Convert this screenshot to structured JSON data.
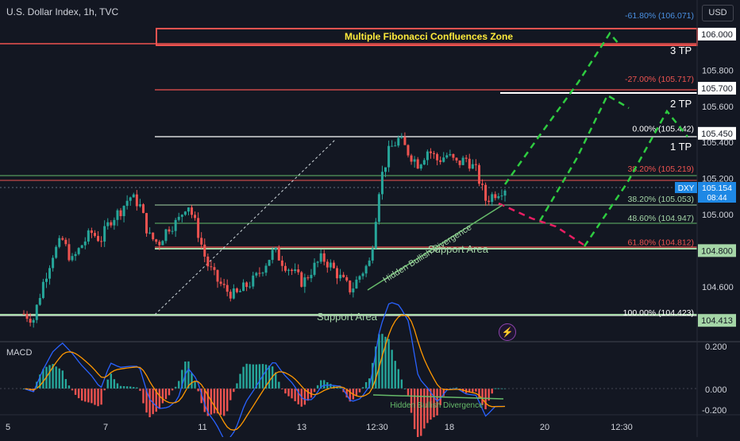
{
  "header": {
    "title": "U.S. Dollar Index, 1h, TVC",
    "currency_button": "USD"
  },
  "macd": {
    "label": "MACD",
    "axis_ticks": [
      "0.200",
      "0.000",
      "-0.200"
    ]
  },
  "annotations": {
    "confluence_zone": "Multiple Fibonacci Confluences Zone",
    "tp1": "1 TP",
    "tp2": "2 TP",
    "tp3": "3 TP",
    "support_upper": "Support Area",
    "support_lower": "Support Area",
    "hidden_div_price": "Hidden Bullish Divergence",
    "hidden_div_macd": "Hidden Bullish Divergence"
  },
  "fib_labels": [
    {
      "text": "-61.80% (106.071)",
      "value": 106.071,
      "color": "#4a90e2"
    },
    {
      "text": "-27.00% (105.717)",
      "value": 105.717,
      "color": "#ef5350"
    },
    {
      "text": "0.00% (105.442)",
      "value": 105.442,
      "color": "#ffffff"
    },
    {
      "text": "38.20% (105.219)",
      "value": 105.219,
      "color": "#ef5350"
    },
    {
      "text": "38.20% (105.053)",
      "value": 105.053,
      "color": "#a5d6a7"
    },
    {
      "text": "48.60% (104.947)",
      "value": 104.947,
      "color": "#a5d6a7"
    },
    {
      "text": "61.80% (104.812)",
      "value": 104.812,
      "color": "#ef5350"
    },
    {
      "text": "100.00% (104.423)",
      "value": 104.423,
      "color": "#ffffff"
    }
  ],
  "price_badges": [
    {
      "text": "106.000",
      "value": 106.0,
      "bg": "#ffffff",
      "fg": "#131722"
    },
    {
      "text": "105.700",
      "value": 105.7,
      "bg": "#ffffff",
      "fg": "#131722"
    },
    {
      "text": "105.450",
      "value": 105.45,
      "bg": "#ffffff",
      "fg": "#131722"
    },
    {
      "text": "104.800",
      "value": 104.8,
      "bg": "#a5d6a7",
      "fg": "#131722"
    },
    {
      "text": "104.413",
      "value": 104.413,
      "bg": "#a5d6a7",
      "fg": "#131722"
    }
  ],
  "current_price": {
    "symbol": "DXY",
    "price": "105.154",
    "countdown": "08:44",
    "value": 105.154
  },
  "chart_data": {
    "type": "candlestick",
    "title": "U.S. Dollar Index, 1h, TVC",
    "y_ticks": [
      105.8,
      105.6,
      105.4,
      105.2,
      105.0,
      104.6
    ],
    "y_tick_labels": [
      "105.800",
      "105.600",
      "105.400",
      "105.200",
      "105.000",
      "104.600"
    ],
    "ylim": [
      104.27,
      106.16
    ],
    "x_tick_labels": [
      "5",
      "7",
      "11",
      "13",
      "12:30",
      "18",
      "20",
      "12:30"
    ],
    "close_path": [
      [
        0,
        104.45
      ],
      [
        1,
        104.42
      ],
      [
        2,
        104.62
      ],
      [
        3,
        104.78
      ],
      [
        4,
        104.86
      ],
      [
        5,
        104.74
      ],
      [
        6,
        104.83
      ],
      [
        7,
        104.9
      ],
      [
        8,
        104.86
      ],
      [
        9,
        104.97
      ],
      [
        10,
        105.02
      ],
      [
        11,
        105.1
      ],
      [
        12,
        105.06
      ],
      [
        13,
        104.88
      ],
      [
        14,
        104.84
      ],
      [
        15,
        104.93
      ],
      [
        16,
        104.96
      ],
      [
        17,
        105.07
      ],
      [
        18,
        104.92
      ],
      [
        19,
        104.73
      ],
      [
        20,
        104.64
      ],
      [
        21,
        104.58
      ],
      [
        22,
        104.55
      ],
      [
        23,
        104.6
      ],
      [
        24,
        104.64
      ],
      [
        25,
        104.72
      ],
      [
        26,
        104.8
      ],
      [
        27,
        104.73
      ],
      [
        28,
        104.68
      ],
      [
        29,
        104.62
      ],
      [
        30,
        104.7
      ],
      [
        31,
        104.76
      ],
      [
        32,
        104.71
      ],
      [
        33,
        104.64
      ],
      [
        34,
        104.58
      ],
      [
        35,
        104.67
      ],
      [
        36,
        104.74
      ],
      [
        37,
        105.18
      ],
      [
        38,
        105.36
      ],
      [
        39,
        105.42
      ],
      [
        40,
        105.34
      ],
      [
        41,
        105.28
      ],
      [
        42,
        105.36
      ],
      [
        43,
        105.3
      ],
      [
        44,
        105.33
      ],
      [
        45,
        105.28
      ],
      [
        46,
        105.31
      ],
      [
        47,
        105.24
      ],
      [
        48,
        105.08
      ],
      [
        49,
        105.12
      ],
      [
        50,
        105.15
      ]
    ]
  }
}
